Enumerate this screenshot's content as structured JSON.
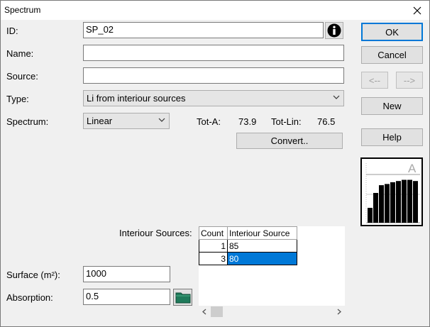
{
  "window": {
    "title": "Spectrum"
  },
  "fields": {
    "id_label": "ID:",
    "id_value": "SP_02",
    "name_label": "Name:",
    "name_value": "",
    "source_label": "Source:",
    "source_value": "",
    "type_label": "Type:",
    "type_value": "Li from interiour sources",
    "spectrum_label": "Spectrum:",
    "spectrum_value": "Linear"
  },
  "totals": {
    "tota_label": "Tot-A:",
    "tota_value": "73.9",
    "totlin_label": "Tot-Lin:",
    "totlin_value": "76.5"
  },
  "buttons": {
    "ok": "OK",
    "cancel": "Cancel",
    "prev": "<--",
    "next": "-->",
    "new": "New",
    "help": "Help",
    "convert": "Convert.."
  },
  "chart": {
    "weighting_letter": "A",
    "bar_levels": [
      0.25,
      0.5,
      0.63,
      0.65,
      0.68,
      0.7,
      0.72,
      0.72,
      0.7
    ]
  },
  "sources": {
    "label": "Interiour Sources:",
    "columns": [
      "Count",
      "Interiour Source"
    ],
    "rows": [
      {
        "count": "1",
        "source": "85"
      },
      {
        "count": "3",
        "source": "80"
      }
    ]
  },
  "surface": {
    "label": "Surface (m²):",
    "value": "1000"
  },
  "absorption": {
    "label": "Absorption:",
    "value": "0.5"
  },
  "colors": {
    "accent": "#0078d7",
    "folder": "#1f7a5a"
  }
}
